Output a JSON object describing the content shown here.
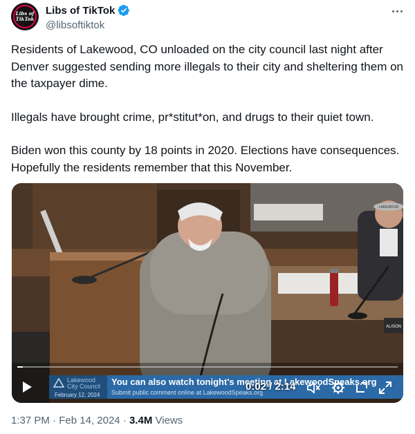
{
  "author": {
    "display_name": "Libs of TikTok",
    "handle": "@libsoftiktok",
    "avatar_logo_line1": "Libs of",
    "avatar_logo_line2": "TikTok",
    "verified_color": "#1d9bf0"
  },
  "tweet": {
    "paragraphs": [
      "Residents of Lakewood, CO unloaded on the city council last night after Denver suggested sending more illegals to their city and sheltering them on the taxpayer dime.",
      "Illegals have brought crime, pr*stitut*on, and drugs to their quiet town.",
      "Biden won this county by 18 points in 2020. Elections have consequences. Hopefully the residents remember that this November."
    ]
  },
  "video": {
    "current_time": "0:02",
    "duration": "2:14",
    "time_display": "0:02 / 2:14",
    "progress_fraction": 0.015,
    "lower_third": {
      "org": "Lakewood City Council",
      "org_line1": "Lakewood",
      "org_line2": "City Council",
      "date": "February 12, 2024",
      "headline": "You can also watch tonight's meeting at LakewoodSpeaks.org",
      "subline": "Submit public comment online at LakewoodSpeaks.org"
    },
    "corner_logo": "LAKEWOOD",
    "nameplate_fragment": "ALISON",
    "controls": [
      "play-icon",
      "mute-icon",
      "settings-icon",
      "picture-in-picture-icon",
      "fullscreen-icon"
    ]
  },
  "meta": {
    "time": "1:37 PM",
    "separator": "·",
    "date": "Feb 14, 2024",
    "views_count": "3.4M",
    "views_label": "Views"
  },
  "colors": {
    "text": "#0f1419",
    "secondary": "#536471",
    "accent": "#1d9bf0",
    "lower_third_blue": "#2b6aa6"
  }
}
